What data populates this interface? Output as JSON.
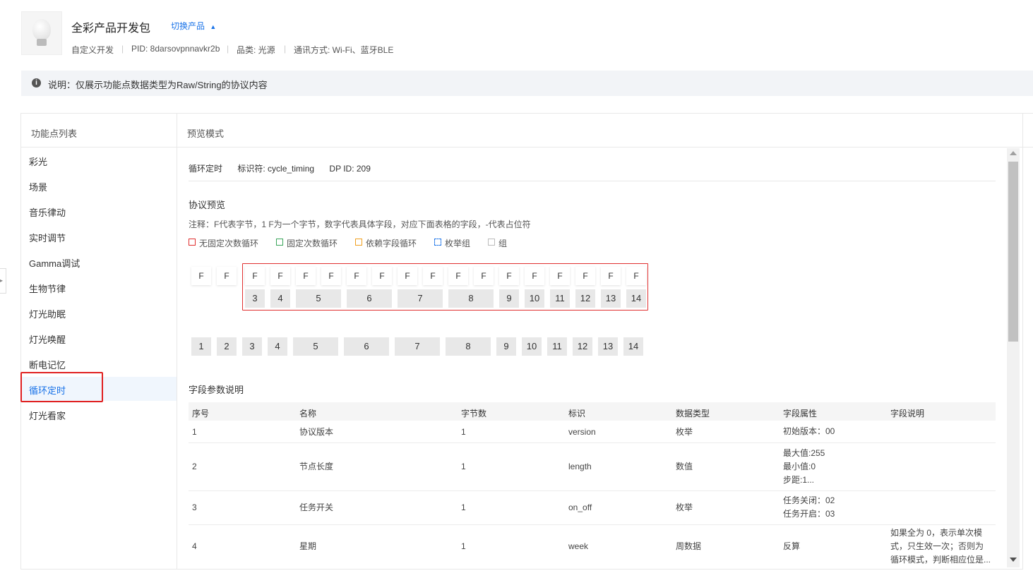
{
  "header": {
    "title": "全彩产品开发包",
    "switch_label": "切换产品",
    "meta": {
      "dev_type": "自定义开发",
      "pid": "PID:  8darsovpnnavkr2b",
      "category": "品类:  光源",
      "comm": "通讯方式:  Wi-Fi、蓝牙BLE"
    }
  },
  "notice": {
    "text": "说明：仅展示功能点数据类型为Raw/String的协议内容"
  },
  "left_panel": {
    "title": "功能点列表",
    "items": [
      "彩光",
      "场景",
      "音乐律动",
      "实时调节",
      "Gamma调试",
      "生物节律",
      "灯光助眠",
      "灯光唤醒",
      "断电记忆",
      "循环定时",
      "灯光看家"
    ],
    "active_index": 9
  },
  "right_panel": {
    "title": "预览模式",
    "dp": {
      "name": "循环定时",
      "identifier": "标识符:  cycle_timing",
      "dp_id": "DP ID:  209"
    },
    "protocol": {
      "title": "协议预览",
      "note": "注释：F代表字节，1 F为一个字节，数字代表具体字段，对应下面表格的字段，-代表占位符",
      "legend": [
        {
          "label": "无固定次数循环",
          "color": "#e03030",
          "style": "solid"
        },
        {
          "label": "固定次数循环",
          "color": "#3aa55a",
          "style": "solid"
        },
        {
          "label": "依赖字段循环",
          "color": "#f0a020",
          "style": "solid"
        },
        {
          "label": "枚举组",
          "color": "#1a73e8",
          "style": "dashed"
        },
        {
          "label": "组",
          "color": "#bbbbbb",
          "style": "solid"
        }
      ],
      "byte_label": "F",
      "loop_fields": [
        "3",
        "4",
        "5",
        "6",
        "7",
        "8",
        "9",
        "10",
        "11",
        "12",
        "13",
        "14"
      ],
      "flat_fields": [
        "1",
        "2",
        "3",
        "4",
        "5",
        "6",
        "7",
        "8",
        "9",
        "10",
        "11",
        "12",
        "13",
        "14"
      ]
    },
    "fields": {
      "title": "字段参数说明",
      "columns": [
        "序号",
        "名称",
        "字节数",
        "标识",
        "数据类型",
        "字段属性",
        "字段说明"
      ],
      "rows": [
        {
          "no": "1",
          "name": "协议版本",
          "bytes": "1",
          "id": "version",
          "type": "枚举",
          "attr": [
            "初始版本：00"
          ],
          "desc": []
        },
        {
          "no": "2",
          "name": "节点长度",
          "bytes": "1",
          "id": "length",
          "type": "数值",
          "attr": [
            "最大值:255",
            "最小值:0",
            "步距:1..."
          ],
          "desc": []
        },
        {
          "no": "3",
          "name": "任务开关",
          "bytes": "1",
          "id": "on_off",
          "type": "枚举",
          "attr": [
            "任务关闭：02",
            "任务开启：03"
          ],
          "desc": []
        },
        {
          "no": "4",
          "name": "星期",
          "bytes": "1",
          "id": "week",
          "type": "周数据",
          "attr": [
            "反算"
          ],
          "desc": [
            "如果全为 0，表示单次模",
            "式，只生效一次；否则为",
            "循环模式，判断相应位是..."
          ]
        }
      ]
    }
  }
}
